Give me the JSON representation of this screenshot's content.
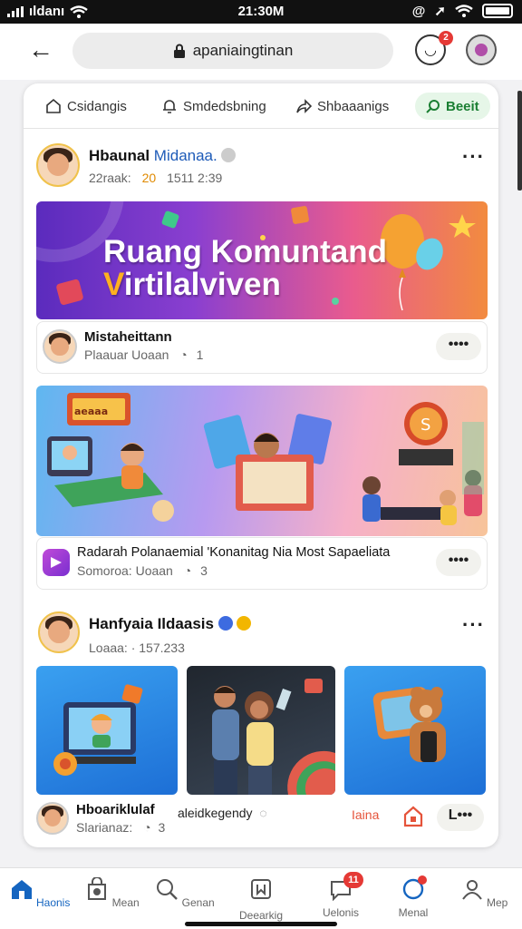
{
  "status_bar": {
    "carrier": "ıldanı",
    "time": "21:30M"
  },
  "browser": {
    "url": "apaniaingtinan",
    "notif_badge": "2"
  },
  "tabs": [
    {
      "label": "Csidangis",
      "icon": "home-icon"
    },
    {
      "label": "Smdedsbning",
      "icon": "bell-icon"
    },
    {
      "label": "Shbaaanigs",
      "icon": "share-icon"
    },
    {
      "label": "Beeit",
      "icon": "search-icon",
      "active": true
    }
  ],
  "post1": {
    "author": "Hbaunal",
    "author_highlight": "Midanaa.",
    "meta_prefix": "22raak:",
    "meta_num": "20",
    "meta_rest": "1511 2:39",
    "banner_line1": "Ruang Komuntand",
    "banner_line2_v": "V",
    "banner_line2_rest": "irtilalviven",
    "sub_name": "Mistaheittann",
    "sub_meta": "Plaauar  Uoaan",
    "sub_count": "1",
    "sub_more": "••••"
  },
  "post2": {
    "title": "Radarah Polanaemial 'Konanitag Nia  Most Sapaeliata",
    "meta": "Somoroa:  Uoaan",
    "count": "3",
    "more": "••••",
    "sign_text": "aeaaa"
  },
  "post3": {
    "author": "Hanfyaia Ildaasis",
    "meta": "Loaaa:  · 157.233",
    "footer_name": "Hboariklulaf",
    "footer_sub": "Slarianaz:",
    "footer_count": "3",
    "footer_link": "aleidkegendy",
    "footer_tag": "Iaina",
    "footer_more": "L•••"
  },
  "nav": [
    {
      "label": "Haonis",
      "icon": "home-icon",
      "active": true
    },
    {
      "label": "Mean",
      "icon": "store-icon"
    },
    {
      "label": "Genan",
      "icon": "search-icon"
    },
    {
      "label": "Deearkig",
      "icon": "bookmark-icon"
    },
    {
      "label": "Uelonis",
      "icon": "chat-icon",
      "badge": "11"
    },
    {
      "label": "Menal",
      "icon": "notification-icon"
    },
    {
      "label": "Mep",
      "icon": "profile-icon"
    }
  ],
  "colors": {
    "accent": "#1565c0",
    "active_tab": "#1b7f33",
    "badge": "#e53935"
  }
}
